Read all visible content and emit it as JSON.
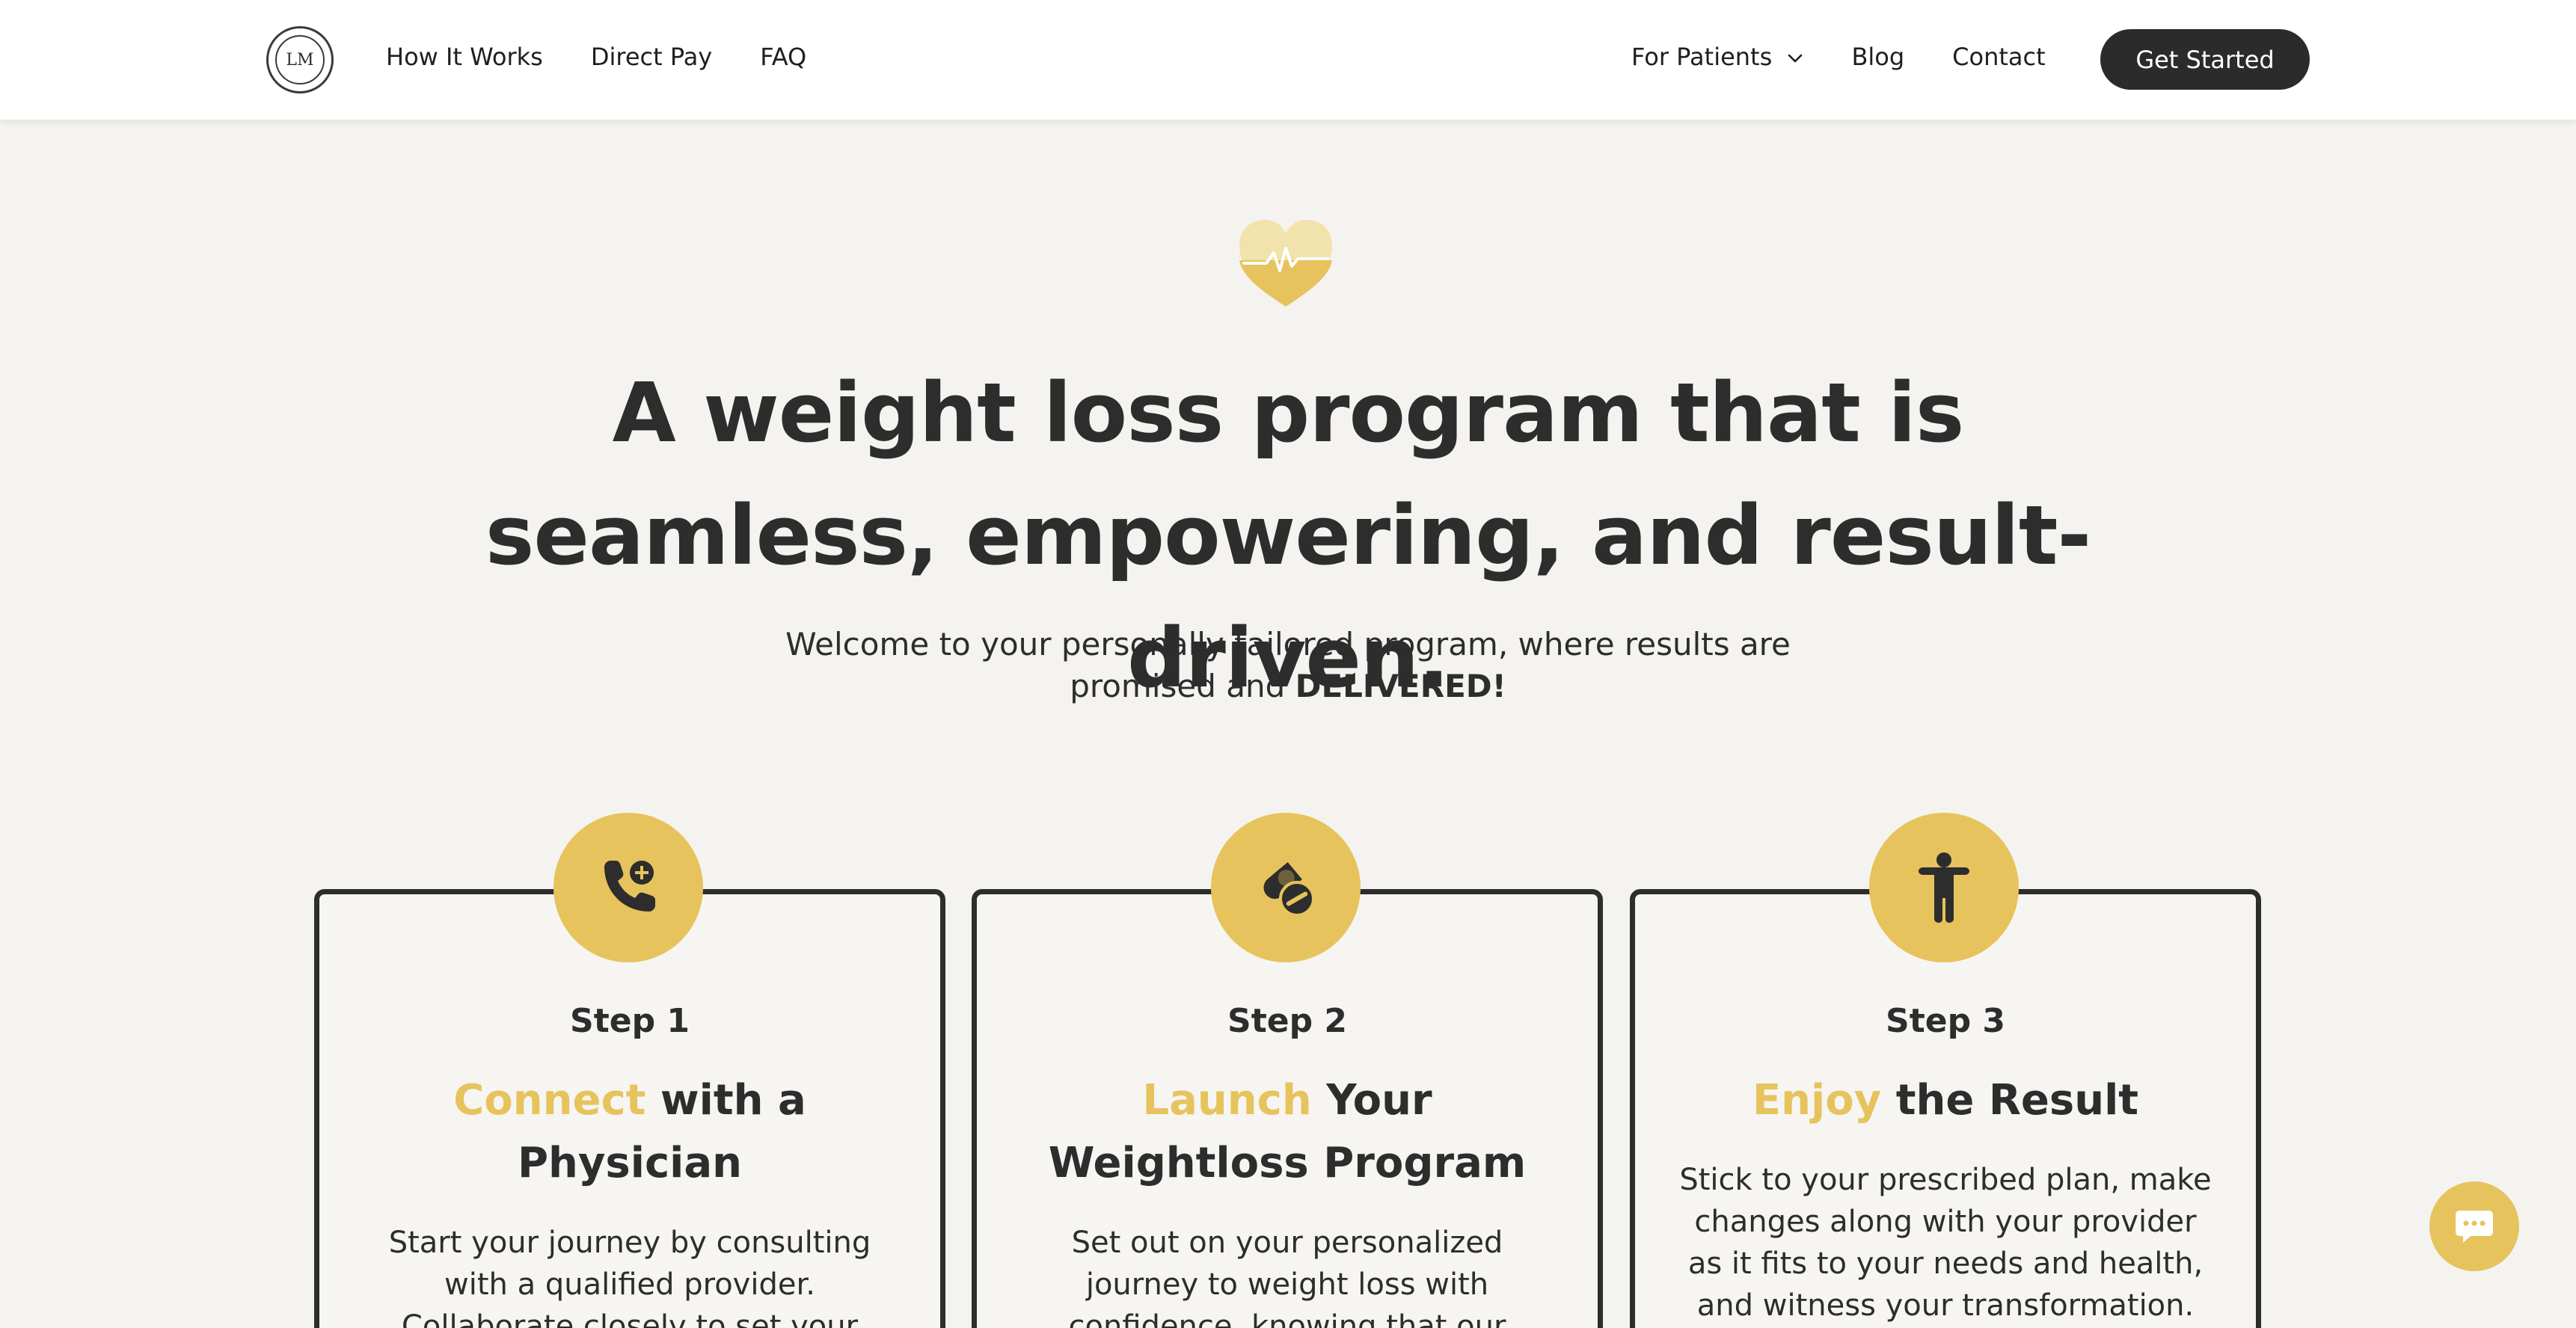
{
  "header": {
    "logo_text": "LM",
    "nav_left": [
      "How It Works",
      "Direct Pay",
      "FAQ"
    ],
    "nav_right": [
      "For Patients",
      "Blog",
      "Contact"
    ],
    "cta_label": "Get Started"
  },
  "hero": {
    "title": "A weight loss program that is seamless, empowering, and result-driven.",
    "subtitle_text": "Welcome to your personally tailored program, where results are promised and ",
    "subtitle_bold": "DELIVERED!"
  },
  "steps": [
    {
      "label": "Step 1",
      "title_accent": "Connect",
      "title_rest": " with a Physician",
      "description": "Start your journey by consulting with a qualified provider. Collaborate closely to set your",
      "icon": "phone-plus-icon"
    },
    {
      "label": "Step 2",
      "title_accent": "Launch",
      "title_rest": " Your Weightloss Program",
      "description": "Set out on your personalized journey to weight loss with confidence, knowing that our",
      "icon": "pills-icon"
    },
    {
      "label": "Step 3",
      "title_accent": "Enjoy",
      "title_rest": " the Result",
      "description": "Stick to your prescribed plan, make changes along with your provider as it fits to your needs and health, and witness your transformation.",
      "icon": "person-icon"
    }
  ],
  "colors": {
    "accent": "#e6c35c",
    "dark": "#2d2d2d",
    "background": "#f5f3f0"
  }
}
